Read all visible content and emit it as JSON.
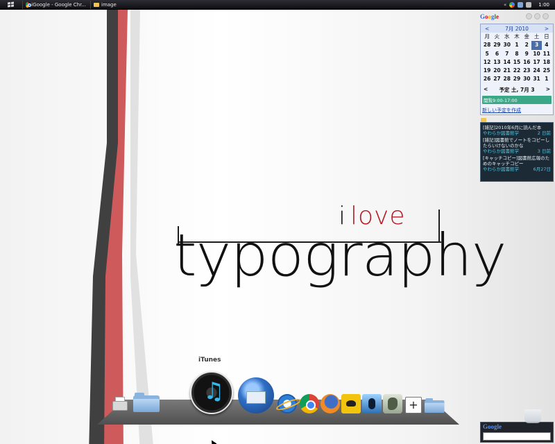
{
  "taskbar": {
    "tasks": [
      {
        "label": "iGoogle - Google Chr...",
        "icon": "chrome-icon"
      },
      {
        "label": "image",
        "icon": "folder-icon"
      }
    ],
    "tray_chevron": "«",
    "clock": "1:00"
  },
  "wallpaper": {
    "small_i": "i",
    "small_love": "love",
    "big_word": "typography",
    "accent_color": "#b51a24"
  },
  "google_gadget": {
    "logo": "Google"
  },
  "calendar": {
    "prev": "<",
    "month_label": "7月 2010",
    "next": ">",
    "weekdays": [
      "月",
      "火",
      "水",
      "木",
      "金",
      "土",
      "日"
    ],
    "weeks": [
      [
        "28",
        "29",
        "30",
        "1",
        "2",
        "3",
        "4"
      ],
      [
        "5",
        "6",
        "7",
        "8",
        "9",
        "10",
        "11"
      ],
      [
        "12",
        "13",
        "14",
        "15",
        "16",
        "17",
        "18"
      ],
      [
        "19",
        "20",
        "21",
        "22",
        "23",
        "24",
        "25"
      ],
      [
        "26",
        "27",
        "28",
        "29",
        "30",
        "31",
        "1"
      ]
    ],
    "today": "3",
    "agenda_prev": "<",
    "agenda_label": "予定 土, 7月 3",
    "agenda_next": ">",
    "event": "閲覧9:00-17:00",
    "create_link": "新しい予定を作成"
  },
  "feed": {
    "items": [
      {
        "title": "[雑記]2010年6月に読んだ本",
        "source": "やわらか図書館学",
        "date": "2 日前"
      },
      {
        "title": "[雑記]図書館でノートをコピーしたらいけないのかな",
        "source": "やわらか図書館学",
        "date": "3 日前"
      },
      {
        "title": "[キャッチコピー]図書館広報のためのキャッチコピー",
        "source": "やわらか図書館学",
        "date": "6月27日"
      }
    ]
  },
  "search_gadget": {
    "logo": "Google",
    "value": ""
  },
  "dock": {
    "hover_label": "iTunes",
    "add_label": "+"
  }
}
